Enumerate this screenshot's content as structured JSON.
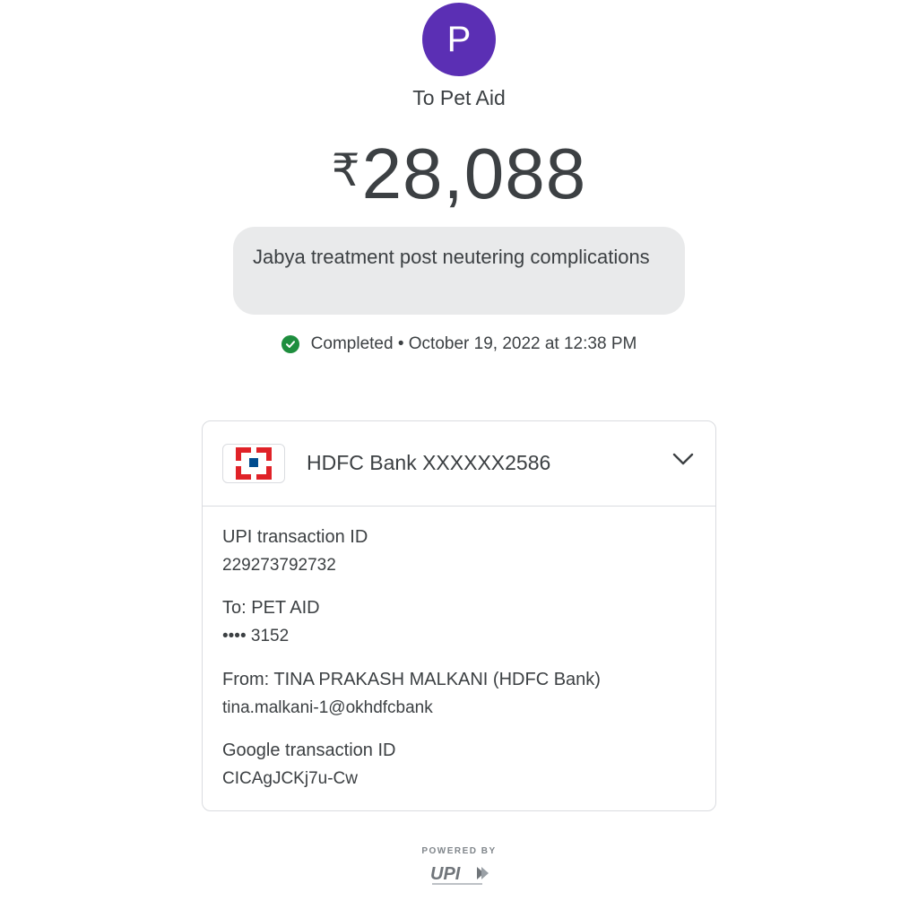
{
  "payee": {
    "avatar_initial": "P",
    "avatar_color": "#5b2fb4",
    "title": "To Pet Aid"
  },
  "amount": {
    "currency": "₹",
    "value": "28,088"
  },
  "note": "Jabya treatment post neutering complications",
  "status": {
    "icon": "check-circle-icon",
    "color": "#1e8e3e",
    "text": "Completed • October 19, 2022 at 12:38 PM"
  },
  "bank": {
    "name": "HDFC Bank XXXXXX2586",
    "logo_colors": {
      "red": "#e02228",
      "blue": "#004c8f"
    }
  },
  "details": [
    {
      "label": "UPI transaction ID",
      "value": "229273792732"
    },
    {
      "label": "To: PET AID",
      "value": "•••• 3152"
    },
    {
      "label": "From: TINA PRAKASH MALKANI (HDFC Bank)",
      "value": "tina.malkani-1@okhdfcbank"
    },
    {
      "label": "Google transaction ID",
      "value": "CICAgJCKj7u-Cw"
    }
  ],
  "footer": {
    "powered_by": "POWERED BY",
    "logo": "UPI"
  }
}
